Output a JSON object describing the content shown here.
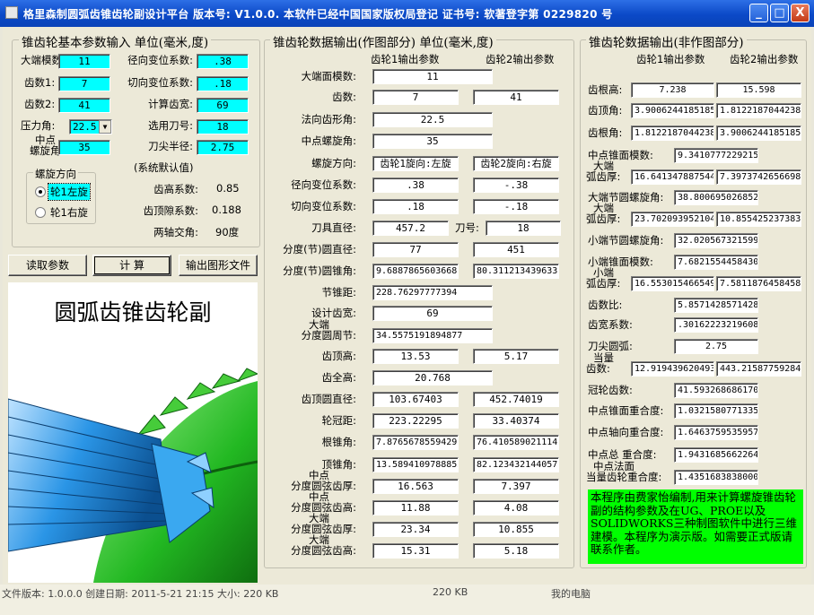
{
  "title": "格里森制圆弧齿锥齿轮副设计平台 版本号: V1.0.0. 本软件已经中国国家版权局登记 证书号: 软著登字第 0229820 号",
  "controls": {
    "min": "_",
    "max": "□",
    "close": "X"
  },
  "input": {
    "title": "锥齿轮基本参数输入 单位(毫米,度)",
    "module_label": "大端模数:",
    "module": "11",
    "radial_label": "径向变位系数:",
    "radial": ".38",
    "z1_label": "齿数1:",
    "z1": "7",
    "tangential_label": "切向变位系数:",
    "tangential": ".18",
    "z2_label": "齿数2:",
    "z2": "41",
    "calc_width_label": "计算齿宽:",
    "calc_width": "69",
    "pressure_label": "压力角:",
    "pressure": "22.5",
    "cutter_label": "选用刀号:",
    "cutter": "18",
    "spiral_label1": "中点",
    "spiral_label2": "螺旋角:",
    "spiral": "35",
    "tip_r_label": "刀尖半径:",
    "tip_r": "2.75",
    "hand_title": "螺旋方向",
    "left_hand": "轮1左旋",
    "right_hand": "轮1右旋",
    "defaults_title": "(系统默认值)",
    "addendum_label": "齿高系数:",
    "addendum": "0.85",
    "clearance_label": "齿顶隙系数:",
    "clearance": "0.188",
    "shaft_label": "两轴交角:",
    "shaft": "90度"
  },
  "buttons": {
    "read": "读取参数",
    "calc": "计 算",
    "export": "输出图形文件"
  },
  "image_title": "圆弧齿锥齿轮副",
  "mid": {
    "title": "锥齿轮数据输出(作图部分) 单位(毫米,度)",
    "col1": "齿轮1输出参数",
    "col2": "齿轮2输出参数",
    "rows": [
      {
        "label": "大端面模数:",
        "v1": "11"
      },
      {
        "label": "齿数:",
        "v1": "7",
        "v2": "41"
      },
      {
        "label": "法向齿形角:",
        "v1": "22.5"
      },
      {
        "label": "中点螺旋角:",
        "v1": "35"
      },
      {
        "label": "螺旋方向:",
        "v1": "齿轮1旋向:左旋",
        "v2": "齿轮2旋向:右旋"
      },
      {
        "label": "径向变位系数:",
        "v1": ".38",
        "v2": "-.38"
      },
      {
        "label": "切向变位系数:",
        "v1": ".18",
        "v2": "-.18"
      },
      {
        "label": "刀具直径:",
        "v1": "457.2",
        "mid_label": "刀号:",
        "v2": "18"
      },
      {
        "label": "分度(节)圆直径:",
        "v1": "77",
        "v2": "451"
      },
      {
        "label": "分度(节)圆锥角:",
        "v1": "9.6887865603668",
        "v2": "80.3112134396332"
      },
      {
        "label": "节锥距:",
        "v1": "228.76297777394"
      },
      {
        "label": "设计齿宽:",
        "v1": "69"
      },
      {
        "label1": "大端",
        "label": "分度圆周节:",
        "v1": "34.5575191894877"
      },
      {
        "label": "齿顶高:",
        "v1": "13.53",
        "v2": "5.17"
      },
      {
        "label": "齿全高:",
        "v1": "20.768"
      },
      {
        "label": "齿顶圆直径:",
        "v1": "103.67403",
        "v2": "452.74019"
      },
      {
        "label": "轮冠距:",
        "v1": "223.22295",
        "v2": "33.40374"
      },
      {
        "label": "根锥角:",
        "v1": "7.8765678559429",
        "v2": "76.4105890211147"
      },
      {
        "label": "顶锥角:",
        "v1": "13.5894109788853",
        "v2": "82.1234321440571"
      },
      {
        "label1": "中点",
        "label": "分度圆弦齿厚:",
        "v1": "16.563",
        "v2": "7.397"
      },
      {
        "label1": "中点",
        "label": "分度圆弦齿高:",
        "v1": "11.88",
        "v2": "4.08"
      },
      {
        "label1": "大端",
        "label": "分度圆弦齿厚:",
        "v1": "23.34",
        "v2": "10.855"
      },
      {
        "label1": "大端",
        "label": "分度圆弦齿高:",
        "v1": "15.31",
        "v2": "5.18"
      }
    ]
  },
  "right": {
    "title": "锥齿轮数据输出(非作图部分)",
    "col1": "齿轮1输出参数",
    "col2": "齿轮2输出参数",
    "rows": [
      {
        "label": "齿根高:",
        "v1": "7.238",
        "v2": "15.598"
      },
      {
        "label": "齿顶角:",
        "v1": "3.9006244185185",
        "v2": "1.8122187044238"
      },
      {
        "label": "齿根角:",
        "v1": "1.8122187044238",
        "v2": "3.9006244185185"
      },
      {
        "label1": "中点锥面模数:",
        "v1": "9.3410777229215"
      },
      {
        "label1": "大端",
        "label": "弧齿厚:",
        "v1": "16.641347887544",
        "v2": "7.3973742656698"
      },
      {
        "label": "大端节圆螺旋角:",
        "v1": "38.800695026852"
      },
      {
        "label1": "大端",
        "label": "弧齿厚:",
        "v1": "23.702093952104",
        "v2": "10.855425237383"
      },
      {
        "label": "小端节圆螺旋角:",
        "v1": "32.020567321599"
      },
      {
        "label": "小端锥面模数:",
        "v1": "7.6821554458430"
      },
      {
        "label1": "小端",
        "label": "弧齿厚:",
        "v1": "16.553015466549",
        "v2": "7.5811876458458"
      },
      {
        "label": "齿数比:",
        "v1": "5.8571428571428"
      },
      {
        "label": "齿宽系数:",
        "v1": ".30162223219608"
      },
      {
        "label": "刀尖圆弧:",
        "v1": "2.75"
      },
      {
        "label1": "当量",
        "label": "齿数:",
        "v1": "12.919439620493",
        "v2": "443.21587759284"
      },
      {
        "label": "冠轮齿数:",
        "v1": "41.593268686170"
      },
      {
        "label": "中点锥面重合度:",
        "v1": "1.0321580771335"
      },
      {
        "label": "中点轴向重合度:",
        "v1": "1.6463759535957"
      },
      {
        "label": "中点总 重合度:",
        "v1": "1.9431685662264"
      },
      {
        "label1": "中点法面",
        "label": "当量齿轮重合度:",
        "v1": "1.4351683838000"
      }
    ],
    "note": "本程序由费家怡编制,用来计算螺旋锥齿轮副的结构参数及在UG、PROE以及SOLIDWORKS三种制图软件中进行三维建模。本程序为演示版。如需要正式版请联系作者。"
  },
  "footer": {
    "text": "文件版本: 1.0.0.0 创建日期: 2011-5-21 21:15 大小: 220 KB",
    "size": "220 KB",
    "computer": "我的电脑"
  },
  "colors": {
    "title_bar": "#0a45c0",
    "input_highlight": "#00ffff",
    "note_bg": "#00ff00",
    "gear_blue": "#1e90ff",
    "gear_green": "#22b822"
  }
}
